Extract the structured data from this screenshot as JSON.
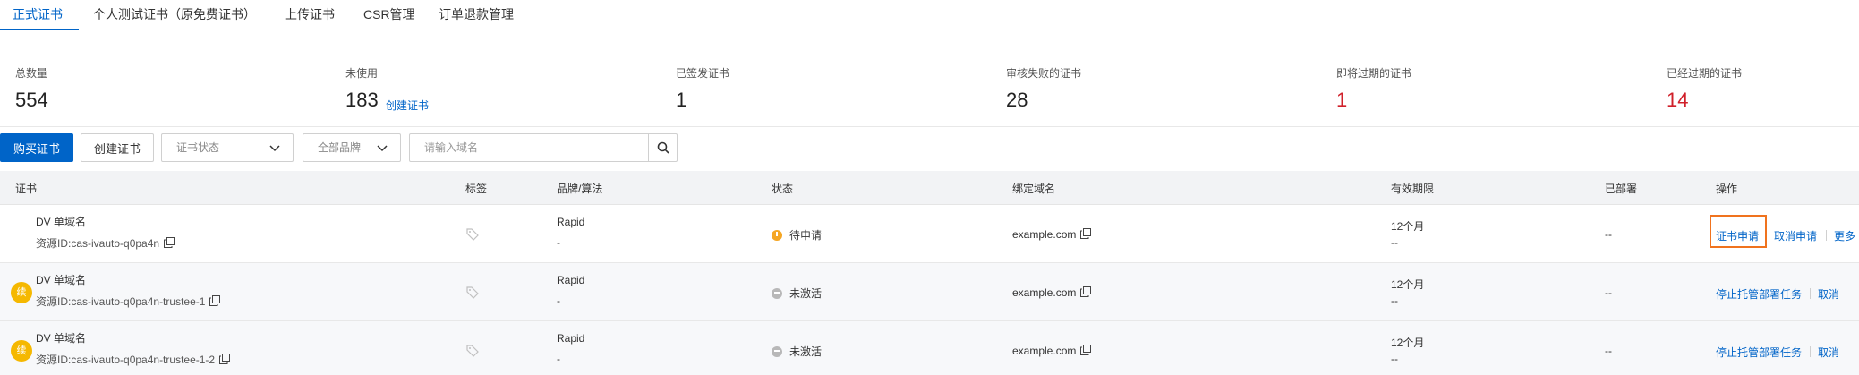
{
  "tabs": [
    {
      "label": "正式证书",
      "active": true
    },
    {
      "label": "个人测试证书（原免费证书）",
      "active": false
    },
    {
      "label": "上传证书",
      "active": false
    },
    {
      "label": "CSR管理",
      "active": false
    },
    {
      "label": "订单退款管理",
      "active": false
    }
  ],
  "stats": {
    "total": {
      "label": "总数量",
      "value": "554"
    },
    "unused": {
      "label": "未使用",
      "value": "183",
      "link": "创建证书"
    },
    "issued": {
      "label": "已签发证书",
      "value": "1"
    },
    "audit_failed": {
      "label": "审核失败的证书",
      "value": "28"
    },
    "expiring": {
      "label": "即将过期的证书",
      "value": "1"
    },
    "expired": {
      "label": "已经过期的证书",
      "value": "14"
    }
  },
  "toolbar": {
    "buy_label": "购买证书",
    "create_label": "创建证书",
    "status_select": "证书状态",
    "brand_select": "全部品牌",
    "search_placeholder": "请输入域名"
  },
  "table": {
    "headers": {
      "cert": "证书",
      "tag": "标签",
      "brand": "品牌/算法",
      "status": "状态",
      "domain": "绑定域名",
      "validity": "有效期限",
      "deployed": "已部署",
      "ops": "操作"
    },
    "rows": [
      {
        "name": "DV 单域名",
        "resource": "资源ID:cas-ivauto-q0pa4n",
        "brand": "Rapid",
        "algo": "-",
        "status": "待申请",
        "domain": "example.com",
        "validity": "12个月",
        "validity_sub": "--",
        "deployed": "--",
        "ops": [
          "证书申请",
          "取消申请",
          "更多"
        ]
      },
      {
        "badge": "续",
        "name": "DV 单域名",
        "resource": "资源ID:cas-ivauto-q0pa4n-trustee-1",
        "brand": "Rapid",
        "algo": "-",
        "status": "未激活",
        "domain": "example.com",
        "validity": "12个月",
        "validity_sub": "--",
        "deployed": "--",
        "ops": [
          "停止托管部署任务",
          "取消"
        ]
      },
      {
        "badge": "续",
        "name": "DV 单域名",
        "resource": "资源ID:cas-ivauto-q0pa4n-trustee-1-2",
        "brand": "Rapid",
        "algo": "-",
        "status": "未激活",
        "domain": "example.com",
        "validity": "12个月",
        "validity_sub": "--",
        "deployed": "--",
        "ops": [
          "停止托管部署任务",
          "取消"
        ]
      }
    ]
  },
  "colors": {
    "accent": "#0064c8",
    "danger": "#d0202a",
    "warning": "#f5a623",
    "timeline": "#f5b800",
    "highlight": "#f0731e"
  }
}
